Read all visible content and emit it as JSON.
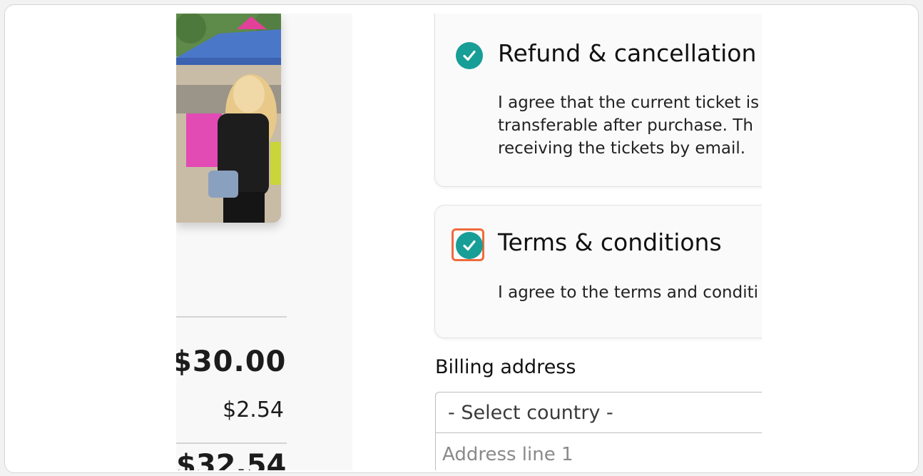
{
  "order_summary": {
    "subtotal": "$30.00",
    "fees": "$2.54",
    "total": "$32.54"
  },
  "agreements": [
    {
      "title": "Refund & cancellation",
      "body_lines": [
        "I agree that the current ticket is",
        "transferable after purchase. Th",
        "receiving the tickets by email."
      ],
      "checked": true
    },
    {
      "title": "Terms & conditions",
      "body_lines": [
        "I agree to the terms and conditi"
      ],
      "checked": true,
      "highlighted": true
    }
  ],
  "billing": {
    "label": "Billing address",
    "country_select": "- Select country -",
    "address_line1_placeholder": "Address line 1"
  },
  "icons": {
    "check": "check-circle-icon"
  },
  "colors": {
    "check_teal": "#169e97",
    "highlight_orange": "#ef6b3c"
  }
}
